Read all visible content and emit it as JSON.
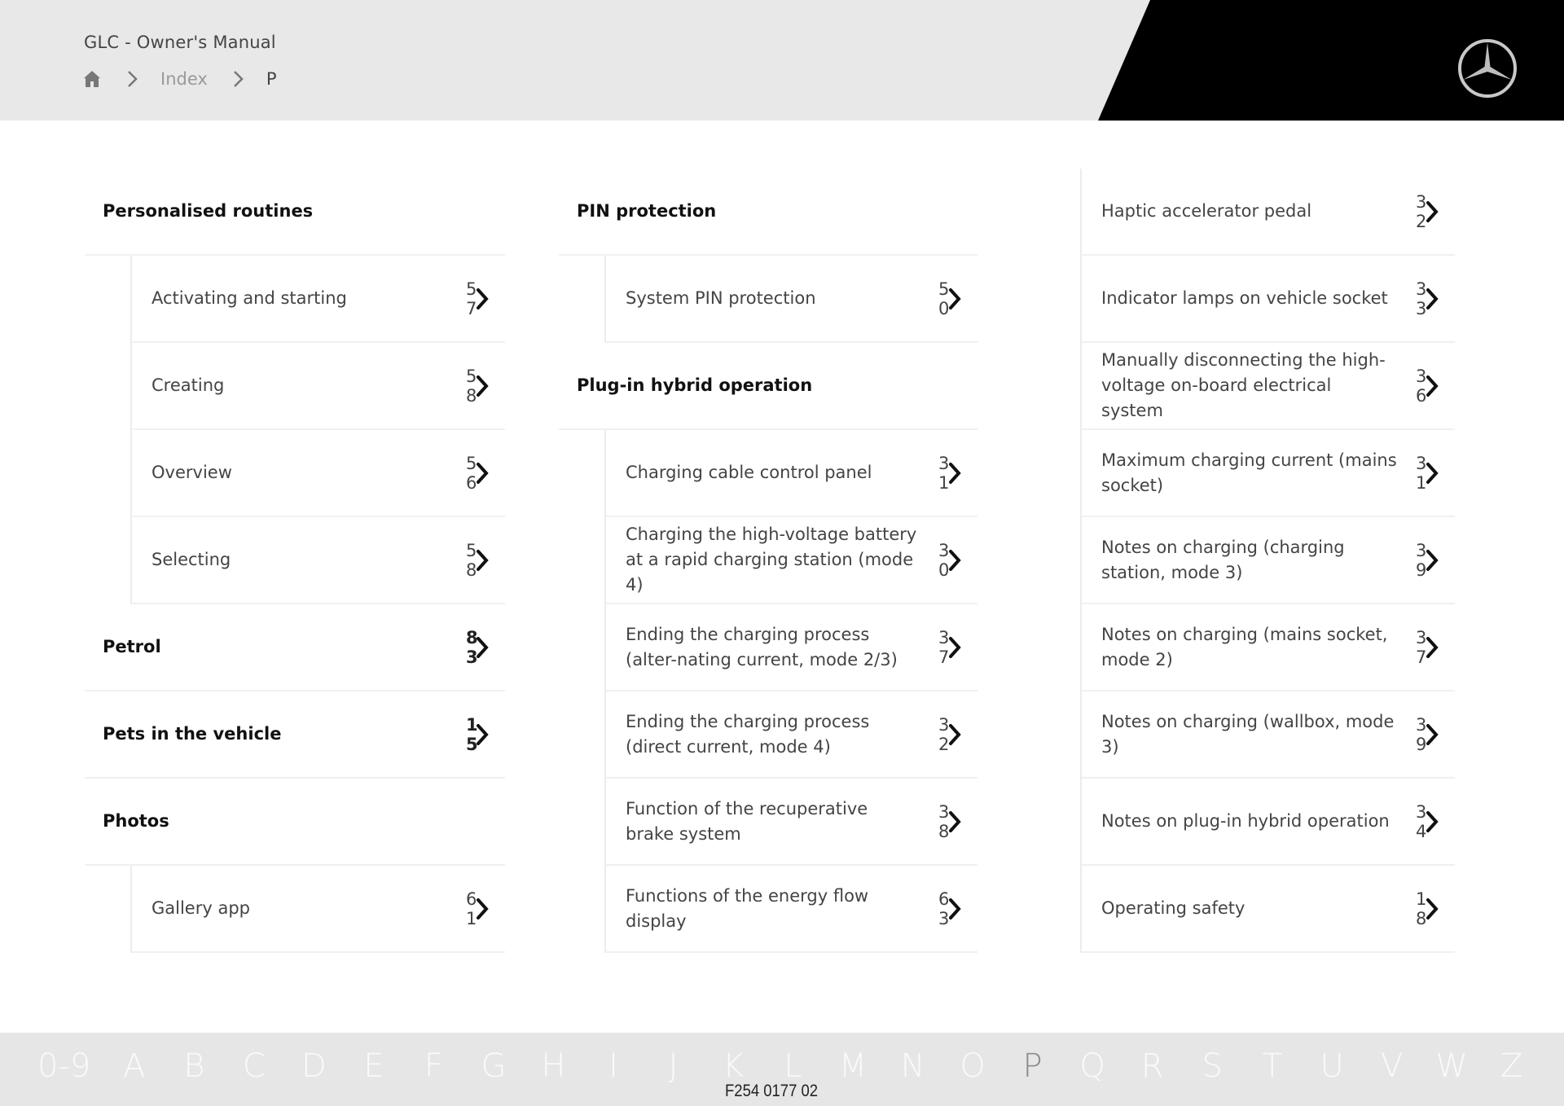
{
  "header": {
    "title": "GLC - Owner's Manual",
    "breadcrumb": {
      "home_icon": "home-icon",
      "separator_icon": "chevron-right-icon",
      "items": [
        "Index",
        "P"
      ]
    },
    "logo_icon": "three-pointed-star-logo-icon"
  },
  "columns": [
    {
      "rows": [
        {
          "type": "heading",
          "label": "Personalised routines",
          "page": ""
        },
        {
          "type": "sub",
          "label": "Activating and starting",
          "page": "5 7"
        },
        {
          "type": "sub",
          "label": "Creating",
          "page": "5 8"
        },
        {
          "type": "sub",
          "label": "Overview",
          "page": "5 6"
        },
        {
          "type": "sub",
          "label": "Selecting",
          "page": "5 8"
        },
        {
          "type": "heading",
          "label": "Petrol",
          "page": "8 3"
        },
        {
          "type": "heading",
          "label": "Pets in the vehicle",
          "page": "1 5"
        },
        {
          "type": "heading",
          "label": "Photos",
          "page": ""
        },
        {
          "type": "sub",
          "label": "Gallery app",
          "page": "6 1"
        }
      ]
    },
    {
      "rows": [
        {
          "type": "heading",
          "label": "PIN protection",
          "page": ""
        },
        {
          "type": "sub",
          "label": "System PIN protection",
          "page": "5 0"
        },
        {
          "type": "heading",
          "label": "Plug-in hybrid operation",
          "page": ""
        },
        {
          "type": "sub",
          "label": "Charging cable control panel",
          "page": "3 1"
        },
        {
          "type": "sub",
          "label": "Charging the high-voltage battery at a rapid charging station (mode 4)",
          "page": "3 0"
        },
        {
          "type": "sub",
          "label": "Ending the charging process (alter-nating current, mode 2/3)",
          "page": "3 7"
        },
        {
          "type": "sub",
          "label": "Ending the charging process (direct current, mode 4)",
          "page": "3 2"
        },
        {
          "type": "sub",
          "label": "Function of the recuperative brake system",
          "page": "3 8"
        },
        {
          "type": "sub",
          "label": "Functions of the energy flow display",
          "page": "6 3"
        }
      ]
    },
    {
      "rows": [
        {
          "type": "item",
          "label": "Haptic accelerator pedal",
          "page": "3 2"
        },
        {
          "type": "item",
          "label": "Indicator lamps on vehicle socket",
          "page": "3 3"
        },
        {
          "type": "item",
          "label": "Manually disconnecting the high-voltage on-board electrical system",
          "page": "3 6"
        },
        {
          "type": "item",
          "label": "Maximum charging current (mains socket)",
          "page": "3 1"
        },
        {
          "type": "item",
          "label": "Notes on charging (charging station, mode 3)",
          "page": "3 9"
        },
        {
          "type": "item",
          "label": "Notes on charging (mains socket, mode 2)",
          "page": "3 7"
        },
        {
          "type": "item",
          "label": "Notes on charging (wallbox, mode 3)",
          "page": "3 9"
        },
        {
          "type": "item",
          "label": "Notes on plug-in hybrid operation",
          "page": "3 4"
        },
        {
          "type": "item",
          "label": "Operating safety",
          "page": "1 8"
        }
      ]
    }
  ],
  "footer": {
    "alphabet": [
      "0-9",
      "A",
      "B",
      "C",
      "D",
      "E",
      "F",
      "G",
      "H",
      "I",
      "J",
      "K",
      "L",
      "M",
      "N",
      "O",
      "P",
      "Q",
      "R",
      "S",
      "T",
      "U",
      "V",
      "W",
      "Z"
    ],
    "active_letter": "P",
    "document_code": "F254 0177 02"
  }
}
